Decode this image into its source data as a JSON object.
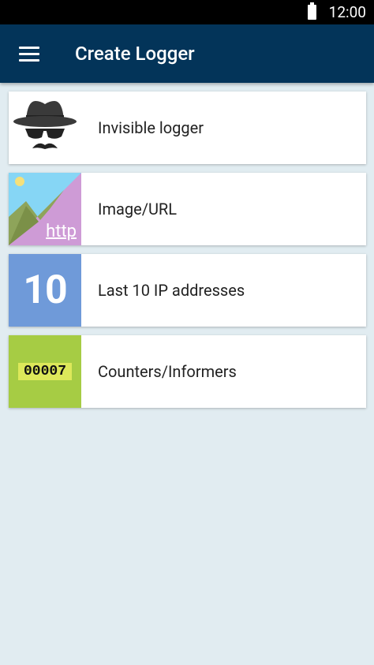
{
  "status_bar": {
    "time": "12:00"
  },
  "app_bar": {
    "title": "Create Logger"
  },
  "items": [
    {
      "label": "Invisible logger",
      "icon": "spy-icon"
    },
    {
      "label": "Image/URL",
      "icon": "image-http-icon",
      "badge": "http"
    },
    {
      "label": "Last 10 IP addresses",
      "icon": "ten-icon",
      "badge": "10"
    },
    {
      "label": "Counters/Informers",
      "icon": "counter-icon",
      "badge": "00007"
    }
  ],
  "colors": {
    "app_bar": "#033459",
    "background": "#e1ecf1",
    "http_thumb": "#ce9bd6",
    "ten_thumb": "#6f9ad9",
    "counter_thumb": "#a6cc44"
  }
}
